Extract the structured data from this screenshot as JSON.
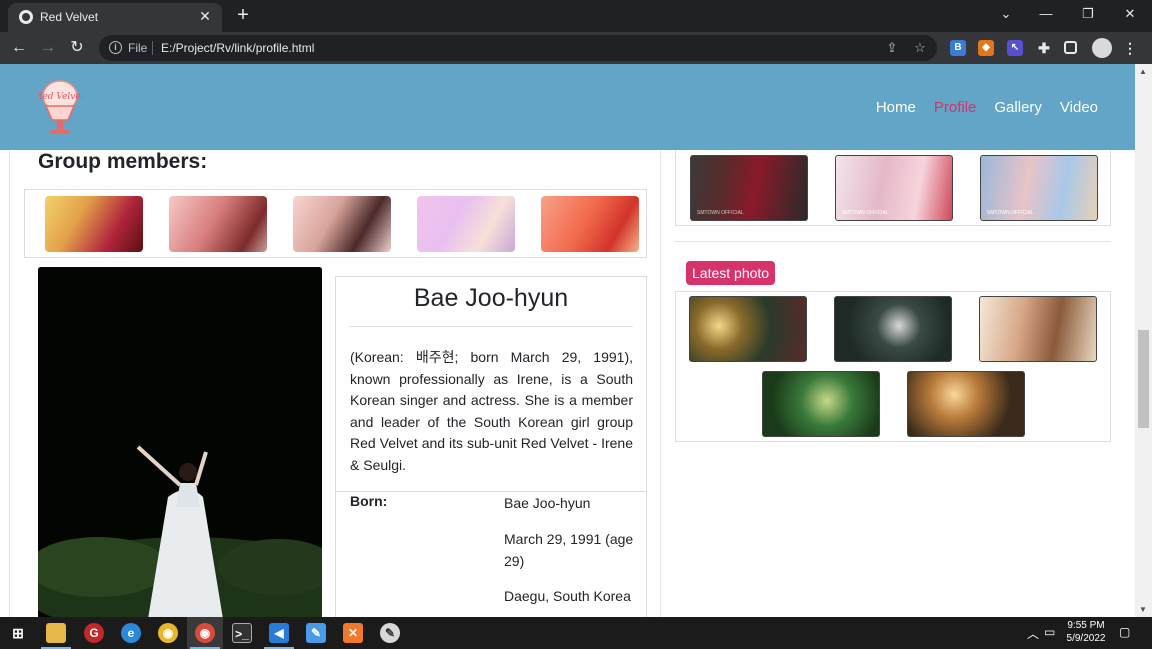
{
  "browser": {
    "tab_title": "Red Velvet",
    "tab_close_icon": "close-icon",
    "new_tab_icon": "plus-icon",
    "url_scheme_label": "File",
    "url": "E:/Project/Rv/link/profile.html",
    "window_controls": [
      "chevron-down-icon",
      "minimize-icon",
      "restore-icon",
      "close-icon"
    ]
  },
  "header": {
    "logo_text": "Red Velvet",
    "nav": [
      "Home",
      "Profile",
      "Gallery",
      "Video"
    ],
    "active_nav": "Profile",
    "active_color": "#d6336c",
    "header_bg": "#62a5c6"
  },
  "members": {
    "title": "Group members:",
    "count": 5
  },
  "profile": {
    "name": "Bae Joo-hyun",
    "bio": "(Korean: 배주현; born March 29, 1991), known professionally as Irene, is a South Korean singer and actress. She is a member and leader of the South Korean girl group Red Velvet and its sub-unit Red Velvet - Irene & Seulgi.",
    "born_label": "Born:",
    "born_name": "Bae Joo-hyun",
    "born_date": "March 29, 1991 (age 29)",
    "born_place": "Daegu, South Korea"
  },
  "sidebar": {
    "video_watermark": "SMTOWN OFFICIAL",
    "latest_photo_label": "Latest photo"
  },
  "taskbar": {
    "time": "9:55 PM",
    "date": "5/9/2022"
  }
}
